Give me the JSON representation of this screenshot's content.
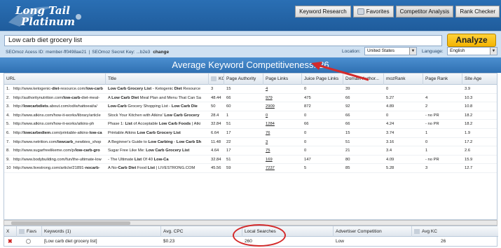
{
  "app": {
    "logo_line1": "Long Tail",
    "logo_line2": "Platinum"
  },
  "tabs": [
    {
      "label": "Keyword Research"
    },
    {
      "label": "Favorites"
    },
    {
      "label": "Competitor Analysis"
    },
    {
      "label": "Rank Checker"
    }
  ],
  "search": {
    "value": "Low carb diet grocery list",
    "analyze_label": "Analyze",
    "seomoz_id": "SEOmoz Acess ID: member-ff0498ae21",
    "seomoz_sep": "|",
    "seomoz_key": "SEOmoz Secret Key: ...b2e3",
    "change_label": "change",
    "location_label": "Location:",
    "location_value": "United States",
    "language_label": "Language:",
    "language_value": "English"
  },
  "avg": {
    "title": "Average Keyword Competitiveness:",
    "value": "26"
  },
  "results": {
    "headers": [
      "URL",
      "Title",
      "KC",
      "Page Authority",
      "Page Links",
      "Juice Page Links",
      "Domain Author...",
      "mozRank",
      "Page Rank",
      "Site Age"
    ],
    "rows": [
      {
        "n": "1.",
        "url_a": "http://www.ketogenic-",
        "url_b": "diet",
        "url_c": "-resource.com/",
        "url_d": "low-carb",
        "title_a": "",
        "title_b": "Low Carb Grocery List",
        "title_c": " - Ketogenic ",
        "title_d": "Diet",
        "title_e": " Resource",
        "kc": "3",
        "pa": "15",
        "pl": "4",
        "jpl": "0",
        "da": "39",
        "mr": "0",
        "pr": "",
        "age": "3.9"
      },
      {
        "n": "2.",
        "url_a": "http://authoritynutrition.com/",
        "url_b": "low-carb",
        "url_c": "-diet-meal-",
        "url_d": "",
        "title_a": "A ",
        "title_b": "Low Carb Diet",
        "title_c": " Meal Plan and Menu That Can Sa",
        "title_d": "",
        "title_e": "",
        "kc": "48.44",
        "pa": "66",
        "pl": "979",
        "jpl": "475",
        "da": "66",
        "mr": "5.27",
        "pr": "4",
        "age": "10.3"
      },
      {
        "n": "3.",
        "url_a": "http://",
        "url_b": "lowcarbdiets",
        "url_c": ".about.com/od/whattoeat/a/",
        "url_d": "",
        "title_a": "",
        "title_b": "Low-Carb",
        "title_c": " Grocery Shopping List - ",
        "title_d": "Low Carb Die",
        "title_e": "",
        "kc": "50",
        "pa": "60",
        "pl": "2909",
        "jpl": "872",
        "da": "92",
        "mr": "4.89",
        "pr": "2",
        "age": "10.8"
      },
      {
        "n": "4.",
        "url_a": "http://www.atkins.com/how-it-works/library/article",
        "url_b": "",
        "url_c": "",
        "url_d": "",
        "title_a": "Stock Your Kitchen with Atkins' ",
        "title_b": "Low Carb Grocery",
        "title_c": "",
        "title_d": "",
        "title_e": "",
        "kc": "28.4",
        "pa": "1",
        "pl": "0",
        "jpl": "0",
        "da": "66",
        "mr": "0",
        "pr": "- no PR",
        "age": "18.2"
      },
      {
        "n": "5.",
        "url_a": "http://www.atkins.com/how-it-works/atkins-ph",
        "url_b": "",
        "url_c": "",
        "url_d": "",
        "title_a": "Phase 1: ",
        "title_b": "List",
        "title_c": " of Acceptable ",
        "title_d": "Low Carb Foods",
        "title_e": " | Atki",
        "kc": "32.84",
        "pa": "51",
        "pl": "1284",
        "jpl": "66",
        "da": "66",
        "mr": "4.24",
        "pr": "- no PR",
        "age": "18.2"
      },
      {
        "n": "6.",
        "url_a": "http://",
        "url_b": "lowcarbediem",
        "url_c": ".com/printable-atkins-",
        "url_d": "low-ca",
        "title_a": "Printable Atkins ",
        "title_b": "Low Carb Grocery List",
        "title_c": "",
        "title_d": "",
        "title_e": "",
        "kc": "6.64",
        "pa": "17",
        "pl": "76",
        "jpl": "0",
        "da": "15",
        "mr": "3.74",
        "pr": "1",
        "age": "1.9"
      },
      {
        "n": "7.",
        "url_a": "http://www.netrition.com/",
        "url_b": "lowcarb",
        "url_c": "_newbies_shop",
        "url_d": "",
        "title_a": "A Beginner's Guide to ",
        "title_b": "Low Carbing",
        "title_c": " - ",
        "title_d": "Low Carb Sh",
        "title_e": "",
        "kc": "11.48",
        "pa": "22",
        "pl": "3",
        "jpl": "0",
        "da": "51",
        "mr": "3.16",
        "pr": "0",
        "age": "17.2"
      },
      {
        "n": "8.",
        "url_a": "http://www.sugarfreelikeme.com/p/",
        "url_b": "low-carb-gro",
        "url_c": "",
        "url_d": "",
        "title_a": "Sugar Free Like Me: ",
        "title_b": "Low Carb Grocery List",
        "title_c": "",
        "title_d": "",
        "title_e": "",
        "kc": "4.64",
        "pa": "17",
        "pl": "75",
        "jpl": "0",
        "da": "21",
        "mr": "3.4",
        "pr": "1",
        "age": "2.6"
      },
      {
        "n": "9.",
        "url_a": "http://www.bodybuilding.com/fun/the-ultimate-low",
        "url_b": "",
        "url_c": "",
        "url_d": "",
        "title_a": "- The Ultimate ",
        "title_b": "List",
        "title_c": " Of 40 ",
        "title_d": "Low-Ca",
        "title_e": "",
        "kc": "32.84",
        "pa": "51",
        "pl": "169",
        "jpl": "147",
        "da": "80",
        "mr": "4.09",
        "pr": "- no PR",
        "age": "15.9"
      },
      {
        "n": "10.",
        "url_a": "http://www.livestrong.com/article/21891-",
        "url_b": "nocarb",
        "url_c": "-",
        "url_d": "",
        "title_a": "A No-",
        "title_b": "Carb Diet",
        "title_c": " Food ",
        "title_d": "List",
        "title_e": " | LIVESTRONG.COM",
        "kc": "45.56",
        "pa": "59",
        "pl": "7237",
        "jpl": "5",
        "da": "85",
        "mr": "5.28",
        "pr": "3",
        "age": "12.7"
      }
    ]
  },
  "keywords": {
    "headers": [
      "X",
      "Favs",
      "Keywords (1)",
      "Avg. CPC",
      "Local Searches",
      "Advertiser Competition",
      "Avg KC"
    ],
    "row": {
      "x": "✖",
      "keyword": "[Low carb diet grocery list]",
      "cpc": "$0.23",
      "local": "260",
      "competition": "Low",
      "avg_kc": "26"
    }
  },
  "colors": {
    "header_blue": "#2a6fb4",
    "title_blue": "#3d80c2",
    "analyze_yellow": "#f4b400",
    "annotation_red": "#d42a2a"
  }
}
